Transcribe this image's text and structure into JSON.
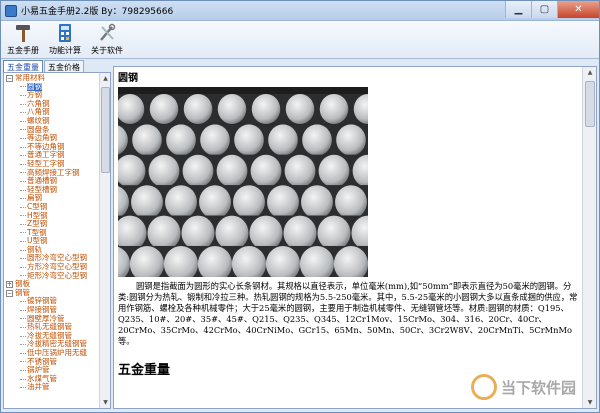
{
  "window": {
    "title": "小易五金手册2.2版 By：798295666"
  },
  "toolbar": {
    "items": [
      {
        "label": "五金手册",
        "icon": "hammer-icon"
      },
      {
        "label": "功能计算",
        "icon": "calculator-icon"
      },
      {
        "label": "关于软件",
        "icon": "tools-icon"
      }
    ]
  },
  "tabs": [
    {
      "label": "五金重量",
      "active": true
    },
    {
      "label": "五金价格",
      "active": false
    }
  ],
  "tree": {
    "groups": [
      {
        "label": "常用材料",
        "expanded": true,
        "children": [
          "圆钢",
          "方钢",
          "六角钢",
          "八角钢",
          "螺纹钢",
          "圆盘条",
          "等边角钢",
          "不等边角钢",
          "普通工字钢",
          "轻型工字钢",
          "高频焊接工字钢",
          "普通槽钢",
          "轻型槽钢",
          "扁钢",
          "C型钢",
          "H型钢",
          "Z型钢",
          "T型钢",
          "U型钢",
          "钢轨",
          "圆形冷弯空心型钢",
          "方形冷弯空心型钢",
          "矩形冷弯空心型钢"
        ]
      },
      {
        "label": "钢板",
        "expanded": false,
        "children": []
      },
      {
        "label": "钢管",
        "expanded": true,
        "children": [
          "镀锌钢管",
          "焊接钢管",
          "圆壁厚冷管",
          "热轧无缝钢管",
          "冷拔无缝钢管",
          "冷拔精密无缝钢管",
          "低中压锅炉用无缝",
          "不锈钢管",
          "锅炉管",
          "水煤气管",
          "油井管"
        ]
      }
    ],
    "selected": "圆钢"
  },
  "content": {
    "section_title": "圆钢",
    "paragraph": "圆钢是指截面为圆形的实心长条钢材。其规格以直径表示，单位毫米(mm),如“50mm”即表示直径为50毫米的圆钢。分类:圆钢分为热轧、锻制和冷拉三种。热轧圆钢的规格为5.5-250毫米。其中，5.5-25毫米的小圆钢大多以直条成捆的供应，常用作钢筋、螺栓及各种机械零件；大于25毫米的圆钢，主要用于制造机械零件、无缝钢管坯等。材质:圆钢的材质：Q195、Q235、10#、20#、35#、45#、Q215、Q235、Q345、12Cr1Mov、15CrMo、304、316、20Cr、40Cr、20CrMo、35CrMo、42CrMo、40CrNiMo、GCr15、65Mn、50Mn、50Cr、3Cr2W8V、20CrMnTi、5CrMnMo等。",
    "next_heading": "五金重量"
  },
  "watermark": {
    "text": "当下软件园"
  },
  "colors": {
    "tree_text": "#c14f00",
    "selection": "#3169c6",
    "title_bar": "#b7cde8"
  }
}
